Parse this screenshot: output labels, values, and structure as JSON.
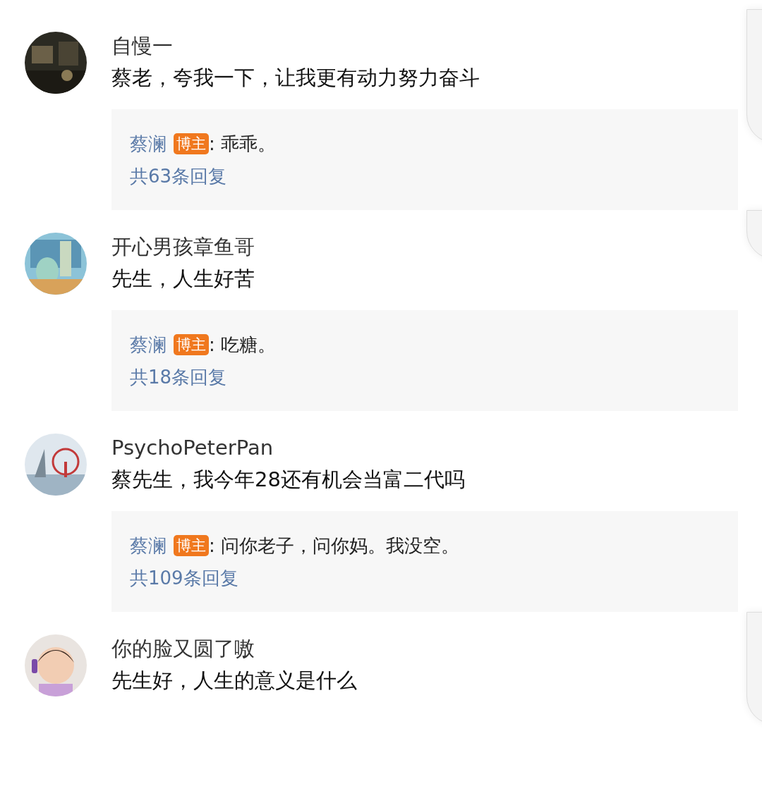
{
  "comments": [
    {
      "user": "自慢一",
      "text": "蔡老，夸我一下，让我更有动力努力奋斗",
      "reply": {
        "author": "蔡澜",
        "badge": "博主",
        "text": ": 乖乖。",
        "count": "共63条回复"
      }
    },
    {
      "user": "开心男孩章鱼哥",
      "text": "先生，人生好苦",
      "reply": {
        "author": "蔡澜",
        "badge": "博主",
        "text": ": 吃糖。",
        "count": "共18条回复"
      }
    },
    {
      "user": "PsychoPeterPan",
      "text": "蔡先生，我今年28还有机会当富二代吗",
      "reply": {
        "author": "蔡澜",
        "badge": "博主",
        "text": ": 问你老子，问你妈。我没空。",
        "count": "共109条回复"
      }
    },
    {
      "user": "你的脸又圆了嗷",
      "text": "先生好，人生的意义是什么"
    }
  ]
}
